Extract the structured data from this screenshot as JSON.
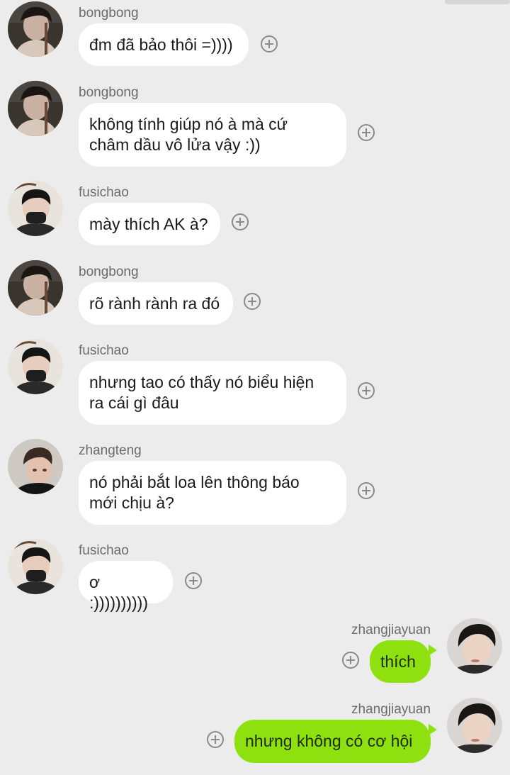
{
  "chat": {
    "messages": [
      {
        "sender": "bongbong",
        "text": "đm đã bảo thôi =))))",
        "side": "left",
        "avatar": "avatar-bongbong"
      },
      {
        "sender": "bongbong",
        "text": "không tính giúp nó à mà cứ\nchâm dầu vô lửa vậy :))",
        "side": "left",
        "avatar": "avatar-bongbong"
      },
      {
        "sender": "fusichao",
        "text": "mày thích AK à?",
        "side": "left",
        "avatar": "avatar-fusichao"
      },
      {
        "sender": "bongbong",
        "text": "rõ rành rành ra đó",
        "side": "left",
        "avatar": "avatar-bongbong"
      },
      {
        "sender": "fusichao",
        "text": "nhưng tao có thấy nó biểu hiện\nra cái gì đâu",
        "side": "left",
        "avatar": "avatar-fusichao"
      },
      {
        "sender": "zhangteng",
        "text": "nó phải bắt loa lên thông báo\nmới chịu à?",
        "side": "left",
        "avatar": "avatar-zhangteng"
      },
      {
        "sender": "fusichao",
        "text": "ơ :))))))))))",
        "side": "left",
        "avatar": "avatar-fusichao"
      },
      {
        "sender": "zhangjiayuan",
        "text": "thích",
        "side": "right",
        "avatar": "avatar-zhangjiayuan"
      },
      {
        "sender": "zhangjiayuan",
        "text": "nhưng không có cơ hội",
        "side": "right",
        "avatar": "avatar-zhangjiayuan"
      }
    ]
  },
  "icons": {
    "add": "plus-circle-icon"
  },
  "colors": {
    "background": "#ececec",
    "incoming_bubble": "#ffffff",
    "outgoing_bubble": "#8ee10f",
    "sender_name": "#6b6b6b",
    "icon": "#8a8a8a"
  }
}
